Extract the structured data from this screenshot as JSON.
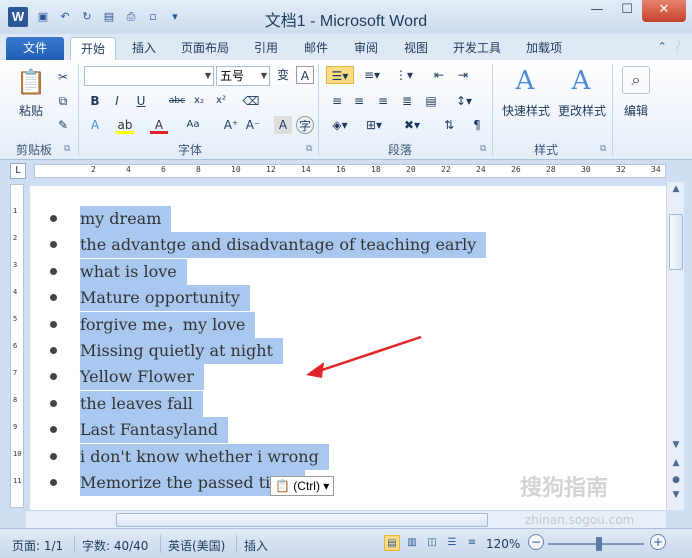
{
  "window": {
    "title": "文档1 - Microsoft Word",
    "app_icon": "W",
    "minimize": "—",
    "restore": "☐",
    "close": "✕"
  },
  "tabs": [
    {
      "label": "文件"
    },
    {
      "label": "开始"
    },
    {
      "label": "插入"
    },
    {
      "label": "页面布局"
    },
    {
      "label": "引用"
    },
    {
      "label": "邮件"
    },
    {
      "label": "审阅"
    },
    {
      "label": "视图"
    },
    {
      "label": "开发工具"
    },
    {
      "label": "加载项"
    }
  ],
  "ribbon": {
    "clipboard": {
      "label": "剪贴板",
      "paste_label": "粘贴"
    },
    "font": {
      "label": "字体",
      "font_name": "",
      "font_size": "五号",
      "bold": "B",
      "italic": "I",
      "underline": "U",
      "strike": "abc",
      "sub": "x₂",
      "sup": "x²"
    },
    "paragraph": {
      "label": "段落"
    },
    "styles": {
      "label": "样式",
      "quick_styles": "快速样式",
      "change_styles": "更改样式"
    },
    "editing": {
      "label": "编辑"
    }
  },
  "ruler": {
    "corner": "L",
    "ticks": [
      "2",
      "4",
      "6",
      "8",
      "10",
      "12",
      "14",
      "16",
      "18",
      "20",
      "22",
      "24",
      "26",
      "28",
      "30",
      "32",
      "34"
    ],
    "vticks": [
      "1",
      "2",
      "3",
      "4",
      "5",
      "6",
      "7",
      "8",
      "9",
      "10",
      "11"
    ]
  },
  "document": {
    "lines": [
      "my dream",
      "the advantge and disadvantage of teaching early",
      "what is love",
      "Mature opportunity",
      "forgive me，my love",
      "Missing quietly at night",
      "Yellow Flower",
      "the leaves fall",
      "Last Fantasyland",
      "i don't know whether i wrong",
      "Memorize the passed time"
    ],
    "paste_options": "(Ctrl)"
  },
  "status": {
    "page": "页面: 1/1",
    "words": "字数: 40/40",
    "language": "英语(美国)",
    "mode": "插入",
    "zoom": "120%"
  },
  "watermark": {
    "text": "搜狗指南",
    "url": "zhinan.sogou.com"
  },
  "colors": {
    "accent": "#2b5797",
    "selection": "#a8c8f0",
    "arrow": "#e0262a"
  }
}
